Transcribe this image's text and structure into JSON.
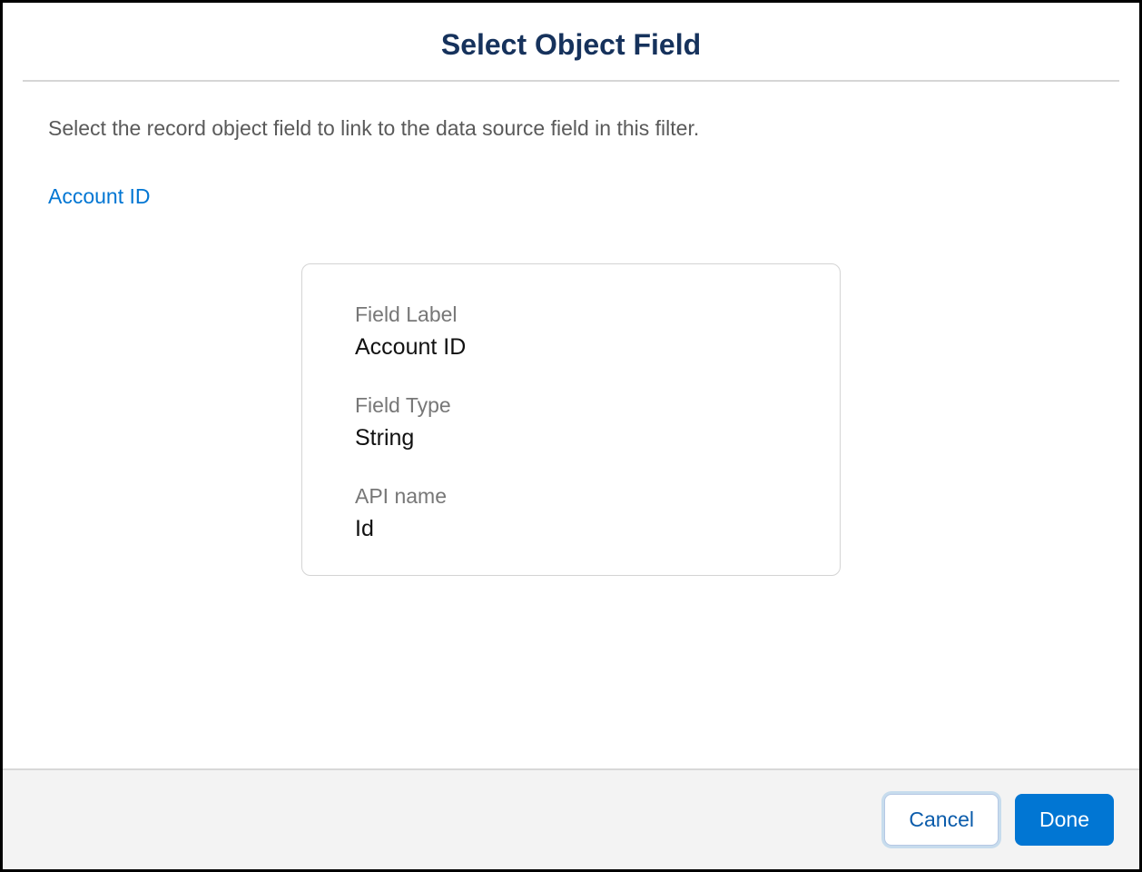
{
  "dialog": {
    "title": "Select Object Field",
    "instruction": "Select the record object field to link to the data source field in this filter.",
    "breadcrumb": "Account ID"
  },
  "field": {
    "label_caption": "Field Label",
    "label_value": "Account ID",
    "type_caption": "Field Type",
    "type_value": "String",
    "api_caption": "API name",
    "api_value": "Id"
  },
  "footer": {
    "cancel": "Cancel",
    "done": "Done"
  }
}
